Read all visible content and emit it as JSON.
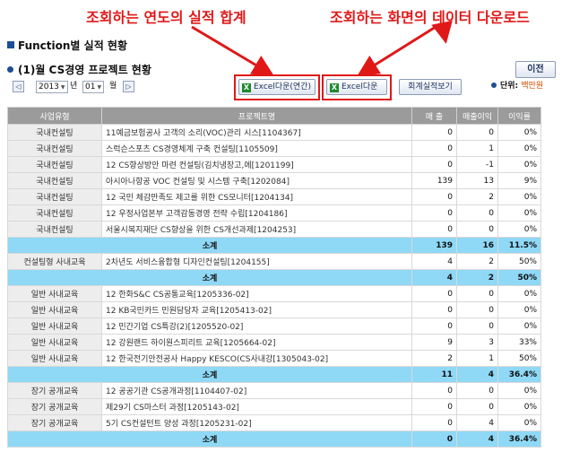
{
  "annotations": {
    "left": "조회하는 연도의 실적 합계",
    "right": "조회하는 화면의 데이터 다운로드"
  },
  "page": {
    "section_title": "Function별 실적 현황",
    "sub_title": "(1)월 CS경영 프로젝트 현황",
    "prev_button": "이전"
  },
  "toolbar": {
    "year": "2013",
    "year_unit": "년",
    "month": "01",
    "month_unit": "월",
    "excel_year_label": "Excel다운(연간)",
    "excel_label": "Excel다운",
    "report_label": "회계실적보기",
    "unit_label": "단위:",
    "unit_value": "백만원"
  },
  "colors": {
    "annotation_red": "#e01818",
    "header_gray": "#9b9b9b",
    "subtotal_blue": "#8fd8f6",
    "accent_navy": "#1c4f96"
  },
  "table": {
    "headers": [
      "사업유형",
      "프로젝트명",
      "매 출",
      "매출이익",
      "이익률"
    ],
    "rows": [
      {
        "type": "row",
        "cat": "국내컨설팅",
        "name": "11예금보험공사 고객의 소리(VOC)관리 시스[1104367]",
        "sales": "0",
        "profit": "0",
        "rate": "0%"
      },
      {
        "type": "row",
        "cat": "국내컨설팅",
        "name": "스럭슨스포츠 CS경영체계 구축 컨설팅[1105509]",
        "sales": "0",
        "profit": "1",
        "rate": "0%"
      },
      {
        "type": "row",
        "cat": "국내컨설팅",
        "name": "12 CS향상방안 마련 컨설팅(김치냉장고,에[1201199]",
        "sales": "0",
        "profit": "-1",
        "rate": "0%"
      },
      {
        "type": "row",
        "cat": "국내컨설팅",
        "name": "아시아나항공 VOC 컨설팅 및 시스템 구축[1202084]",
        "sales": "139",
        "profit": "13",
        "rate": "9%"
      },
      {
        "type": "row",
        "cat": "국내컨설팅",
        "name": "12 국민 체감만족도 제고를 위한 CS모니터[1204134]",
        "sales": "0",
        "profit": "2",
        "rate": "0%"
      },
      {
        "type": "row",
        "cat": "국내컨설팅",
        "name": "12 우정사업본부 고객감동경영 전략 수립[1204186]",
        "sales": "0",
        "profit": "0",
        "rate": "0%"
      },
      {
        "type": "row",
        "cat": "국내컨설팅",
        "name": "서울시복지재단 CS향상을 위한 CS개선과제[1204253]",
        "sales": "0",
        "profit": "0",
        "rate": "0%"
      },
      {
        "type": "sub",
        "cat": "소계",
        "sales": "139",
        "profit": "16",
        "rate": "11.5%"
      },
      {
        "type": "row",
        "cat": "컨설팅형 사내교육",
        "name": "2차년도 서비스융합형 디자인컨설팅[1204155]",
        "sales": "4",
        "profit": "2",
        "rate": "50%"
      },
      {
        "type": "sub",
        "cat": "소계",
        "sales": "4",
        "profit": "2",
        "rate": "50%"
      },
      {
        "type": "row",
        "cat": "일반 사내교육",
        "name": "12 한화S&C CS공통교육[1205336-02]",
        "sales": "0",
        "profit": "0",
        "rate": "0%"
      },
      {
        "type": "row",
        "cat": "일반 사내교육",
        "name": "12 KB국민카드 민원담당자 교육[1205413-02]",
        "sales": "0",
        "profit": "0",
        "rate": "0%"
      },
      {
        "type": "row",
        "cat": "일반 사내교육",
        "name": "12 민간기업 CS특강(2)[1205520-02]",
        "sales": "0",
        "profit": "0",
        "rate": "0%"
      },
      {
        "type": "row",
        "cat": "일반 사내교육",
        "name": "12 강원랜드 하이원스피리트 교육[1205664-02]",
        "sales": "9",
        "profit": "3",
        "rate": "33%"
      },
      {
        "type": "row",
        "cat": "일반 사내교육",
        "name": "12 한국전기안전공사 Happy KESCO(CS사내강[1305043-02]",
        "sales": "2",
        "profit": "1",
        "rate": "50%"
      },
      {
        "type": "sub",
        "cat": "소계",
        "sales": "11",
        "profit": "4",
        "rate": "36.4%"
      },
      {
        "type": "row",
        "cat": "장기 공개교육",
        "name": "12 공공기관 CS공개과정[1104407-02]",
        "sales": "0",
        "profit": "0",
        "rate": "0%"
      },
      {
        "type": "row",
        "cat": "장기 공개교육",
        "name": "제29기 CS마스터 과정[1205143-02]",
        "sales": "0",
        "profit": "0",
        "rate": "0%"
      },
      {
        "type": "row",
        "cat": "장기 공개교육",
        "name": "5기 CS컨설턴트 양성 과정[1205231-02]",
        "sales": "0",
        "profit": "4",
        "rate": "0%"
      },
      {
        "type": "sub",
        "cat": "소계",
        "sales": "0",
        "profit": "4",
        "rate": "36.4%"
      }
    ]
  }
}
